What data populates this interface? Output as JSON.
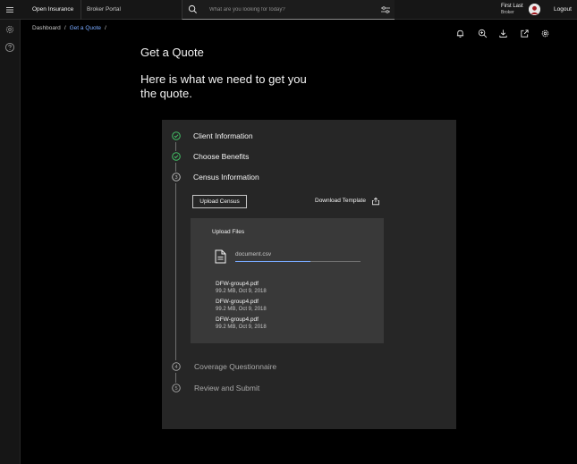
{
  "header": {
    "brand": "Open Insurance",
    "portal": "Broker Portal",
    "search_placeholder": "What are you looking for today?",
    "user_name": "First Last",
    "user_role": "Broker",
    "logout_label": "Logout"
  },
  "breadcrumb": {
    "items": [
      "Dashboard",
      "Get a Quote"
    ],
    "separator": "/"
  },
  "page": {
    "title": "Get a Quote",
    "subtitle": "Here is what we need to get you the quote."
  },
  "steps": [
    {
      "label": "Client Information",
      "status": "complete",
      "icon": "checkmark-circle-icon"
    },
    {
      "label": "Choose Benefits",
      "status": "complete",
      "icon": "checkmark-circle-icon"
    },
    {
      "label": "Census Information",
      "status": "current",
      "number": "3"
    },
    {
      "label": "Coverage Questionnaire",
      "status": "pending",
      "number": "4"
    },
    {
      "label": "Review and Submit",
      "status": "pending",
      "number": "5"
    }
  ],
  "census": {
    "upload_button": "Upload Census",
    "download_label": "Download Template",
    "upload_title": "Upload Files",
    "uploading_file": "document.csv",
    "upload_progress": 0.6,
    "files": [
      {
        "name": "DFW-group4.pdf",
        "meta": "99.2 MB, Oct 9, 2018"
      },
      {
        "name": "DFW-group4.pdf",
        "meta": "99.2 MB, Oct 9, 2018"
      },
      {
        "name": "DFW-group4.pdf",
        "meta": "99.2 MB, Oct 9, 2018"
      }
    ]
  },
  "colors": {
    "success": "#42be65",
    "accent": "#78a9ff",
    "panel": "#262626",
    "upload_box": "#393939"
  }
}
